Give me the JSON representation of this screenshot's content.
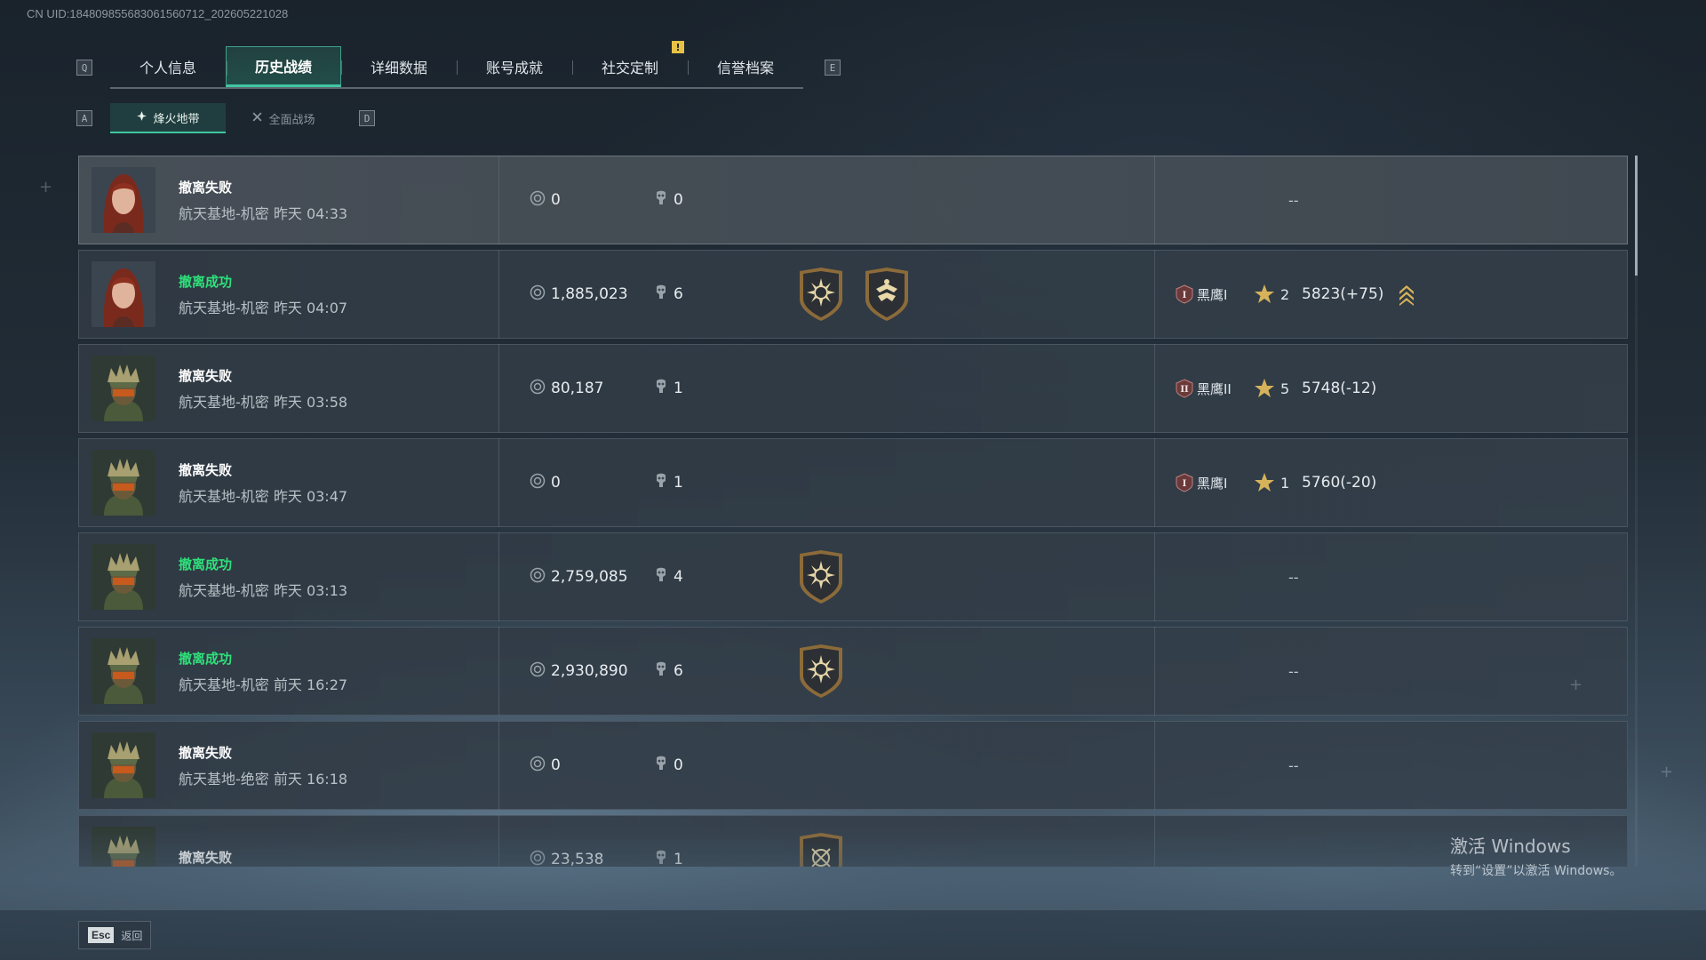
{
  "uid_text": "CN UID:18480985568306156071​2_202605221028",
  "top_tabs": {
    "left_key": "Q",
    "right_key": "E",
    "items": [
      {
        "label": "个人信息",
        "active": false
      },
      {
        "label": "历史战绩",
        "active": true
      },
      {
        "label": "详细数据",
        "active": false
      },
      {
        "label": "账号成就",
        "active": false
      },
      {
        "label": "社交定制",
        "active": false,
        "notification": "!"
      },
      {
        "label": "信誉档案",
        "active": false
      }
    ]
  },
  "sub_tabs": {
    "left_key": "A",
    "right_key": "D",
    "items": [
      {
        "label": "烽火地带",
        "active": true,
        "icon": "operations-icon"
      },
      {
        "label": "全面战场",
        "active": false,
        "icon": "warfare-icon"
      }
    ]
  },
  "matches": [
    {
      "status": "撤离失败",
      "success": false,
      "avatar": "female-operator",
      "map_time": "航天基地-机密 昨天 04:33",
      "money": "0",
      "kills": "0",
      "medals": [],
      "rank": null,
      "rank_placeholder": "--"
    },
    {
      "status": "撤离成功",
      "success": true,
      "avatar": "female-operator",
      "map_time": "航天基地-机密 昨天 04:07",
      "money": "1,885,023",
      "kills": "6",
      "medals": [
        "sun-medal",
        "eagle-medal"
      ],
      "rank": {
        "tier": "I",
        "name": "黑鹰I",
        "stars": "2",
        "score": "5823(+75)",
        "up": true
      }
    },
    {
      "status": "撤离失败",
      "success": false,
      "avatar": "male-operator",
      "map_time": "航天基地-机密 昨天 03:58",
      "money": "80,187",
      "kills": "1",
      "medals": [],
      "rank": {
        "tier": "II",
        "name": "黑鹰II",
        "stars": "5",
        "score": "5748(-12)",
        "up": false
      }
    },
    {
      "status": "撤离失败",
      "success": false,
      "avatar": "male-operator",
      "map_time": "航天基地-机密 昨天 03:47",
      "money": "0",
      "kills": "1",
      "medals": [],
      "rank": {
        "tier": "I",
        "name": "黑鹰I",
        "stars": "1",
        "score": "5760(-20)",
        "up": false
      }
    },
    {
      "status": "撤离成功",
      "success": true,
      "avatar": "male-operator",
      "map_time": "航天基地-机密 昨天 03:13",
      "money": "2,759,085",
      "kills": "4",
      "medals": [
        "sun-medal"
      ],
      "rank": null,
      "rank_placeholder": "--"
    },
    {
      "status": "撤离成功",
      "success": true,
      "avatar": "male-operator",
      "map_time": "航天基地-机密 前天 16:27",
      "money": "2,930,890",
      "kills": "6",
      "medals": [
        "sun-medal"
      ],
      "rank": null,
      "rank_placeholder": "--"
    },
    {
      "status": "撤离失败",
      "success": false,
      "avatar": "male-operator",
      "map_time": "航天基地-绝密 前天 16:18",
      "money": "0",
      "kills": "0",
      "medals": [],
      "rank": null,
      "rank_placeholder": "--"
    },
    {
      "status": "撤离失败",
      "success": false,
      "avatar": "male-operator",
      "map_time": "",
      "money": "23,538",
      "kills": "1",
      "medals": [
        "crosshair-medal"
      ],
      "rank": null,
      "rank_placeholder": ""
    }
  ],
  "footer": {
    "esc_key": "Esc",
    "back_label": "返回"
  },
  "windows_watermark": {
    "title": "激活 Windows",
    "subtitle": "转到“设置”以激活 Windows。"
  },
  "colors": {
    "success": "#2fe07a",
    "accent": "#3fc6a2",
    "gold": "#d6b25a"
  }
}
